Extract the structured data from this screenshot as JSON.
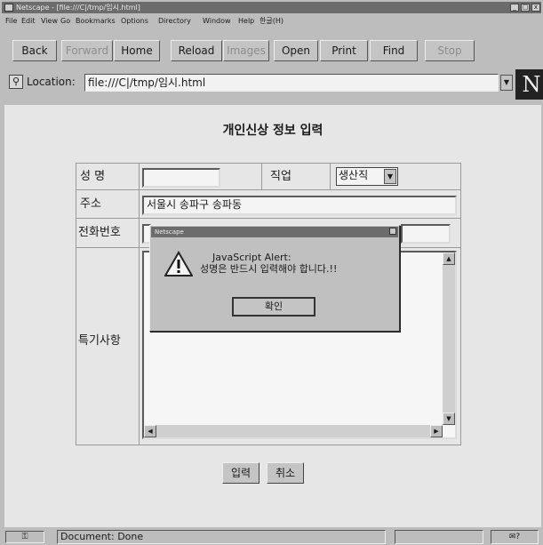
{
  "window": {
    "title": "Netscape - [file:///C|/tmp/임시.html]",
    "min_label": "_",
    "max_label": "□",
    "close_label": "x"
  },
  "menu": [
    "File",
    "Edit",
    "View",
    "Go",
    "Bookmarks",
    "Options",
    "Directory",
    "Window",
    "Help",
    "한글(H)"
  ],
  "toolbar": [
    "Back",
    "Forward",
    "Home",
    "Reload",
    "Images",
    "Open",
    "Print",
    "Find",
    "Stop"
  ],
  "location": {
    "label": "Location:",
    "value": "file:///C|/tmp/임시.html",
    "dropdown": "▼",
    "logo": "N"
  },
  "form": {
    "title": "개인신상 정보 입력",
    "name_label": "성 명",
    "name_value": "",
    "job_label": "직업",
    "job_value": "생산직",
    "address_label": "주소",
    "address_value": "서울시 송파구 송파동",
    "phone_label": "전화번호",
    "notes_label": "특기사항",
    "submit_label": "입력",
    "cancel_label": "취소"
  },
  "alert": {
    "title": "Netscape",
    "line1": "JavaScript Alert:",
    "line2": "성명은 반드시 입력해야 합니다.!!",
    "ok_label": "확인"
  },
  "status": {
    "text": "Document: Done",
    "mail": "✉?"
  }
}
